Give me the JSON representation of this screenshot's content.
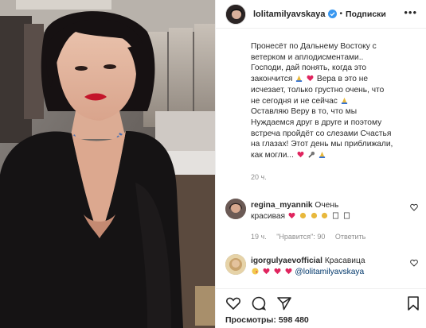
{
  "post": {
    "username": "lolitamilyavskaya",
    "follow_label": "Подписки",
    "caption_lines": [
      "Пронесёт по Дальнему Востоку с",
      "ветерком и аплодисментами..",
      "Господи, дай понять, когда это",
      "закончится",
      "Вера в это не",
      "исчезает, только грустно очень, что",
      "не сегодня и не сейчас",
      "Оставляю Веру в то, что мы",
      "Нуждаемся друг в друге и поэтому",
      "встреча пройдёт со слезами Счастья",
      "на глазах! Этот день мы приближали,",
      "как могли..."
    ],
    "time": "20 ч."
  },
  "comments": [
    {
      "username": "regina_myannik",
      "text": "Очень",
      "text2": "красивая",
      "time": "19 ч.",
      "likes": "\"Нравится\": 90",
      "reply": "Ответить"
    },
    {
      "username": "igorgulyaevofficial",
      "text": "Красавица",
      "mention": "@lolitamilyavskaya"
    }
  ],
  "footer": {
    "views_label": "Просмотры:",
    "views_count": "598 480"
  },
  "colors": {
    "verified": "#3897f0",
    "heart": "#e0245e",
    "link": "#00376b",
    "muted": "#8e8e8e"
  },
  "icons": [
    "more-icon",
    "verified-icon",
    "heart-icon",
    "comment-icon",
    "share-icon",
    "bookmark-icon",
    "praying-hands-emoji",
    "microphone-emoji"
  ]
}
